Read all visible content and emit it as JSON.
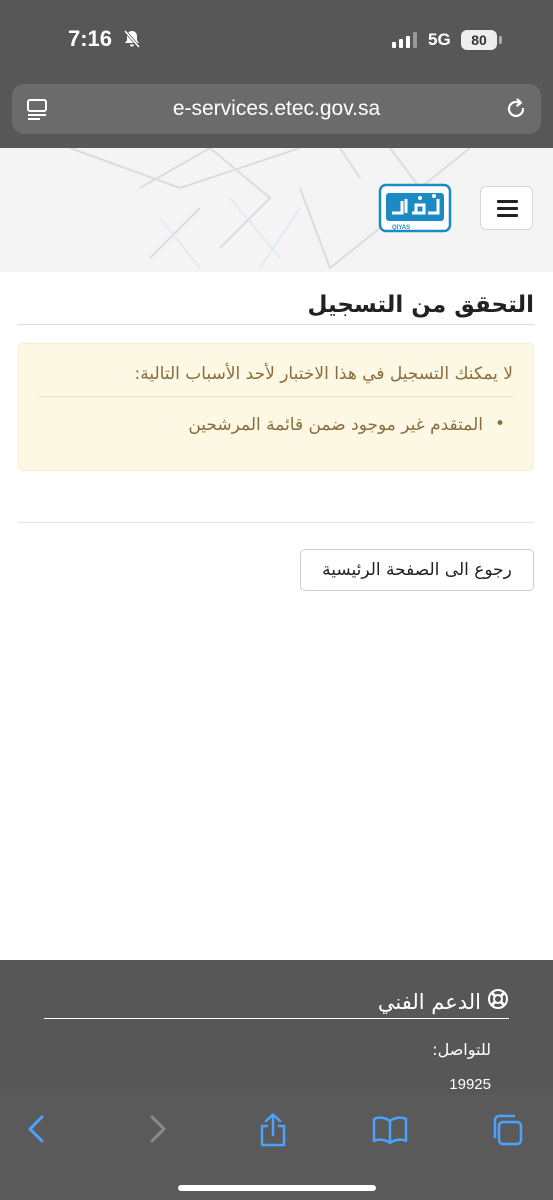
{
  "status": {
    "time": "7:16",
    "network": "5G",
    "battery": "80"
  },
  "browser": {
    "url": "e-services.etec.gov.sa"
  },
  "header": {
    "logo_text": "QIYAS"
  },
  "main": {
    "title": "التحقق من التسجيل",
    "alert_message": "لا يمكنك التسجيل في هذا الاختبار لأحد الأسباب التالية:",
    "reasons": [
      "المتقدم غير موجود ضمن قائمة المرشحين"
    ],
    "back_button": "رجوع الى الصفحة الرئيسية"
  },
  "footer": {
    "support_title": "الدعم الفني",
    "contact_label": "للتواصل:",
    "contact_number": "19925"
  },
  "colors": {
    "chrome": "#575757",
    "alert_bg": "#fcf8e3",
    "alert_text": "#8a6d3b",
    "brand": "#1b8bc6",
    "ios_blue": "#4aa3ff"
  },
  "icons": [
    "bell-slash-icon",
    "reader-icon",
    "reload-icon",
    "hamburger-icon",
    "lifebuoy-icon",
    "back-icon",
    "forward-icon",
    "share-icon",
    "bookmarks-icon",
    "tabs-icon"
  ]
}
